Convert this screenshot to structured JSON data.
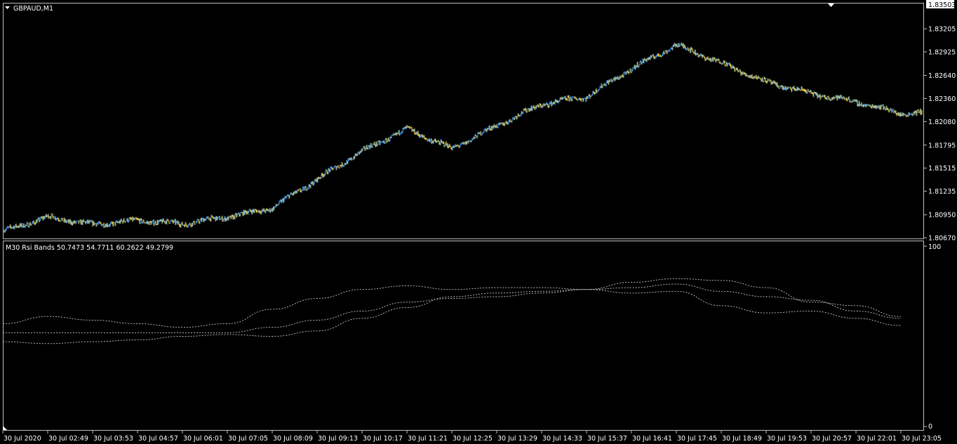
{
  "window": {
    "symbol_title": "GBPAUD,M1"
  },
  "colors": {
    "background": "#000000",
    "frame": "#c0c0c0",
    "candle_up": "#3c8fe0",
    "candle_down": "#f2d14a",
    "indicator_line": "#c8c8c8",
    "text": "#ffffff"
  },
  "icons": {
    "title_marker": "triangle-down-icon",
    "shift_marker": "triangle-down-icon"
  },
  "price_axis": {
    "labels": [
      "1.83503",
      "1.83205",
      "1.82925",
      "1.82640",
      "1.82360",
      "1.82080",
      "1.81795",
      "1.81515",
      "1.81235",
      "1.80950",
      "1.80670"
    ],
    "current_price": "1.83503"
  },
  "indicator": {
    "label": "M30 Rsi Bands 50.7473 54.7711 60.2622 49.2799",
    "axis_top": "100",
    "axis_bottom": "0"
  },
  "time_axis": {
    "labels": [
      "30 Jul 2020",
      "30 Jul 02:49",
      "30 Jul 03:53",
      "30 Jul 04:57",
      "30 Jul 06:01",
      "30 Jul 07:05",
      "30 Jul 08:09",
      "30 Jul 09:13",
      "30 Jul 10:17",
      "30 Jul 11:21",
      "30 Jul 12:25",
      "30 Jul 13:29",
      "30 Jul 14:33",
      "30 Jul 15:37",
      "30 Jul 16:41",
      "30 Jul 17:45",
      "30 Jul 18:49",
      "30 Jul 19:53",
      "30 Jul 20:57",
      "30 Jul 22:01",
      "30 Jul 23:05"
    ]
  },
  "chart_data": [
    {
      "type": "line",
      "title": "GBPAUD,M1",
      "xlabel": "",
      "ylabel": "",
      "ylim": [
        1.8067,
        1.83503
      ],
      "x": [
        "30 Jul 2020",
        "30 Jul 02:49",
        "30 Jul 03:53",
        "30 Jul 04:57",
        "30 Jul 06:01",
        "30 Jul 07:05",
        "30 Jul 08:09",
        "30 Jul 09:13",
        "30 Jul 10:17",
        "30 Jul 11:21",
        "30 Jul 12:25",
        "30 Jul 13:29",
        "30 Jul 14:33",
        "30 Jul 15:37",
        "30 Jul 16:41",
        "30 Jul 17:45",
        "30 Jul 18:49",
        "30 Jul 19:53",
        "30 Jul 20:57",
        "30 Jul 22:01",
        "30 Jul 23:05"
      ],
      "series": [
        {
          "values": [
            1.8075,
            1.8092,
            1.8083,
            1.8088,
            1.8084,
            1.8092,
            1.8103,
            1.8138,
            1.8172,
            1.8199,
            1.8175,
            1.8203,
            1.8229,
            1.8238,
            1.8272,
            1.8301,
            1.8279,
            1.8256,
            1.8242,
            1.8232,
            1.8218
          ]
        }
      ],
      "grid": false
    },
    {
      "type": "line",
      "title": "M30 Rsi Bands 50.7473 54.7711 60.2622 49.2799",
      "ylim": [
        0,
        100
      ],
      "x": [
        "30 Jul 2020",
        "30 Jul 02:49",
        "30 Jul 03:53",
        "30 Jul 04:57",
        "30 Jul 06:01",
        "30 Jul 07:05",
        "30 Jul 08:09",
        "30 Jul 09:13",
        "30 Jul 10:17",
        "30 Jul 11:21",
        "30 Jul 12:25",
        "30 Jul 13:29",
        "30 Jul 14:33",
        "30 Jul 15:37",
        "30 Jul 16:41",
        "30 Jul 17:45",
        "30 Jul 18:49",
        "30 Jul 19:53",
        "30 Jul 20:57",
        "30 Jul 22:01",
        "30 Jul 23:05"
      ],
      "series": [
        {
          "values": [
            57,
            61,
            59,
            57,
            55,
            57,
            65,
            71,
            76,
            78,
            76,
            77,
            77,
            76,
            80,
            82,
            81,
            77,
            69,
            67,
            61
          ]
        },
        {
          "values": [
            52,
            52,
            52,
            52,
            52,
            52,
            55,
            59,
            64,
            69,
            71,
            72,
            74,
            76,
            77,
            79,
            75,
            72,
            70,
            64,
            60
          ]
        },
        {
          "values": [
            47,
            46,
            47,
            48,
            50,
            51,
            50,
            53,
            60,
            66,
            72,
            74,
            75,
            76,
            74,
            75,
            67,
            63,
            64,
            60,
            56
          ]
        }
      ],
      "grid": false
    }
  ]
}
